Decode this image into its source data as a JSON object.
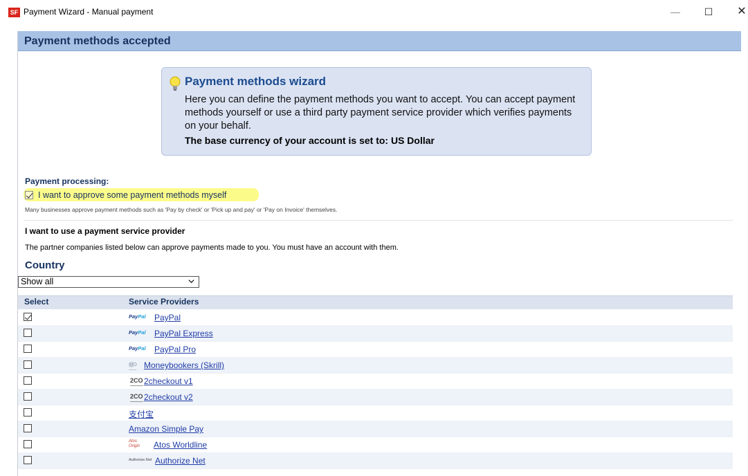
{
  "window": {
    "icon_text": "SF",
    "title": "Payment Wizard - Manual payment",
    "minimize": "—",
    "maximize": "☐",
    "close": "✕"
  },
  "header": {
    "title": "Payment methods accepted"
  },
  "wizard": {
    "title": "Payment methods wizard",
    "text": "Here you can define the payment methods you want to accept. You can accept payment methods yourself or use a third party payment service provider which verifies payments on your behalf.",
    "currency": "The base currency of your account is set to: US Dollar",
    "icon": "lightbulb-icon"
  },
  "processing": {
    "label": "Payment processing:",
    "approve_label": "I want to approve some payment methods myself",
    "approve_checked": true,
    "hint": "Many businesses approve payment methods such as 'Pay by check' or 'Pick up and pay' or 'Pay on Invoice' themselves."
  },
  "psp": {
    "heading": "I want to use a payment service provider",
    "description": "The partner companies listed below can approve payments made to you. You must have an account with them."
  },
  "country": {
    "heading": "Country",
    "selected": "Show all"
  },
  "table": {
    "col_select": "Select",
    "col_providers": "Service Providers",
    "rows": [
      {
        "name": "PayPal",
        "checked": true,
        "logo": "paypal"
      },
      {
        "name": "PayPal Express",
        "checked": false,
        "logo": "paypal"
      },
      {
        "name": "PayPal Pro",
        "checked": false,
        "logo": "paypal"
      },
      {
        "name": "Moneybookers (Skrill)",
        "checked": false,
        "logo": "moneybookers"
      },
      {
        "name": "2checkout v1",
        "checked": false,
        "logo": "2co"
      },
      {
        "name": "2checkout v2",
        "checked": false,
        "logo": "2co"
      },
      {
        "name": "支付宝",
        "checked": false,
        "logo": ""
      },
      {
        "name": "Amazon Simple Pay",
        "checked": false,
        "logo": ""
      },
      {
        "name": "Atos Worldline",
        "checked": false,
        "logo": "atos"
      },
      {
        "name": "Authorize Net",
        "checked": false,
        "logo": "authorize"
      }
    ]
  },
  "logos": {
    "paypal_a": "Pay",
    "paypal_b": "Pal",
    "moneybookers": "((((O",
    "2co": "2CO",
    "atos_a": "Atos",
    "atos_b": "Origin",
    "authorize": "Authorize.Net"
  },
  "colors": {
    "header_bg": "#a7c2e4",
    "header_text": "#17325f",
    "wizard_bg": "#dbe3f3",
    "link": "#1f3ca5",
    "highlight": "#fbfb8a"
  }
}
